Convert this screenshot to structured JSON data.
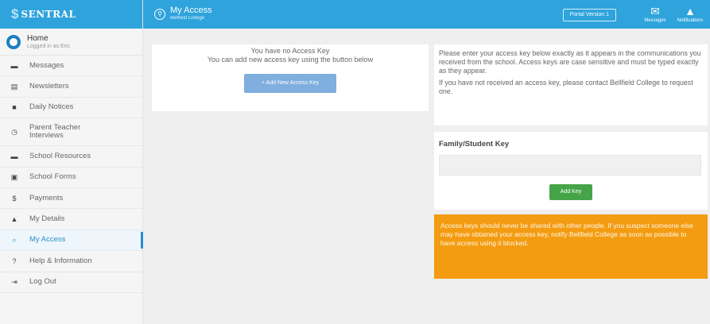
{
  "brand": {
    "mark": "$",
    "name": "SENTRAL"
  },
  "header": {
    "page_icon": "magnifier-key-icon",
    "title": "My Access",
    "subtitle": "Bellfield College",
    "portal_button": "Portal Version 1",
    "messages_label": "Messages",
    "notifications_label": "Notifications",
    "accent_color": "#2ea3dc"
  },
  "sidebar": {
    "home": {
      "title": "Home",
      "subtitle": "Logged in as Eric"
    },
    "items": [
      {
        "label": "Messages",
        "icon": "envelope-icon",
        "glyph": "▬"
      },
      {
        "label": "Newsletters",
        "icon": "newspaper-icon",
        "glyph": "▤"
      },
      {
        "label": "Daily Notices",
        "icon": "notice-icon",
        "glyph": "■"
      },
      {
        "label": "Parent Teacher Interviews",
        "icon": "clock-icon",
        "glyph": "◷"
      },
      {
        "label": "School Resources",
        "icon": "folder-icon",
        "glyph": "▬"
      },
      {
        "label": "School Forms",
        "icon": "form-icon",
        "glyph": "▣"
      },
      {
        "label": "Payments",
        "icon": "dollar-icon",
        "glyph": "$"
      },
      {
        "label": "My Details",
        "icon": "user-icon",
        "glyph": "▲"
      },
      {
        "label": "My Access",
        "icon": "key-search-icon",
        "glyph": "⌕",
        "active": true
      },
      {
        "label": "Help & Information",
        "icon": "question-icon",
        "glyph": "?"
      },
      {
        "label": "Log Out",
        "icon": "logout-icon",
        "glyph": "⇥"
      }
    ]
  },
  "access": {
    "no_key_title": "You have no Access Key",
    "no_key_desc": "You can add new access key using the button below",
    "add_button": "+ Add New Access Key"
  },
  "info": {
    "p1": "Please enter your access key below exactly as it appears in the communications you received from the school. Access keys are case sensitive and must be typed exactly as they appear.",
    "p2": "If you have not received an access key, please contact Bellfield College to request one."
  },
  "key_form": {
    "label": "Family/Student Key",
    "value": "",
    "placeholder": "",
    "submit": "Add Key"
  },
  "warning": {
    "text": "Access keys should never be shared with other people. If you suspect someone else may have obtained your access key, notify Bellfield College as soon as possible to have access using it blocked."
  }
}
